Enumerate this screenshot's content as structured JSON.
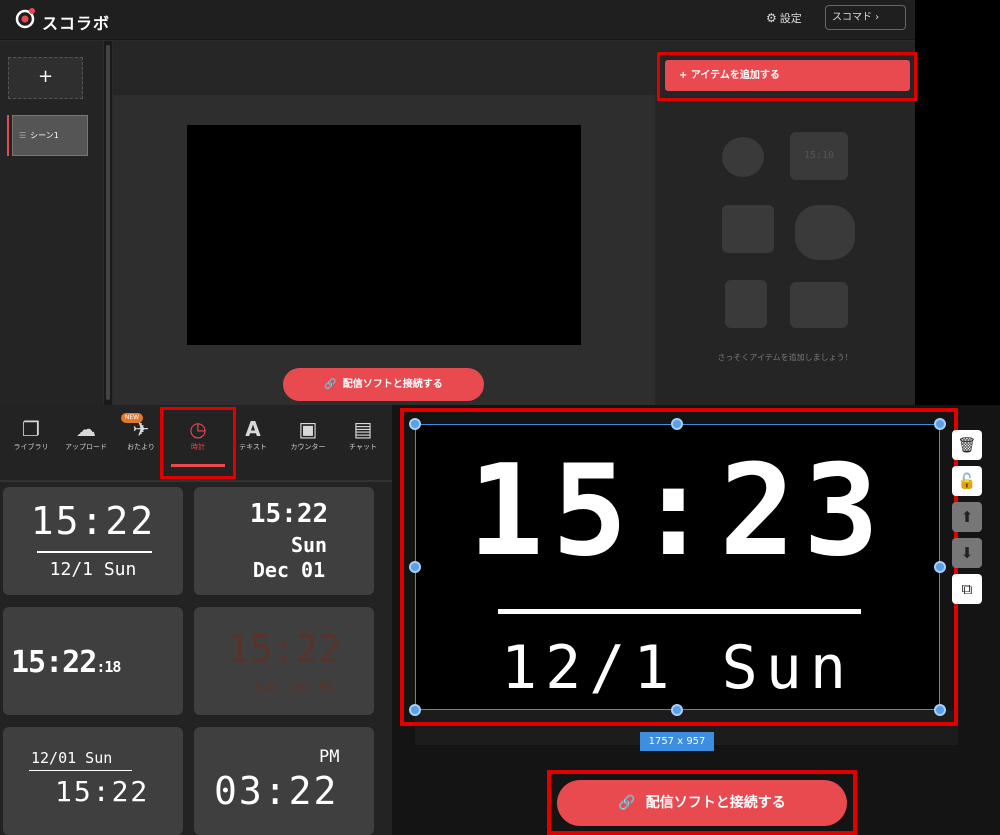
{
  "app": {
    "brand": "スコラボ",
    "settings_label": "設定",
    "sukomado_label": "スコマド ›"
  },
  "scenes": {
    "add_label": "+",
    "items": [
      {
        "label": "シーン1"
      }
    ]
  },
  "items_panel": {
    "add_item_label": "+ アイテムを追加する",
    "empty_hint": "さっそくアイテムを追加しましょう！",
    "illustration_clock": "15:10"
  },
  "connect_label": "配信ソフトと接続する",
  "library_tabs": [
    {
      "label": "ライブラリ",
      "icon": "library-icon"
    },
    {
      "label": "アップロード",
      "icon": "upload-icon"
    },
    {
      "label": "おたより",
      "icon": "paper-plane-icon",
      "badge": "NEW"
    },
    {
      "label": "時計",
      "icon": "clock-icon",
      "active": true
    },
    {
      "label": "テキスト",
      "icon": "text-icon"
    },
    {
      "label": "カウンター",
      "icon": "counter-icon"
    },
    {
      "label": "チャット",
      "icon": "chat-icon"
    }
  ],
  "clock_presets": [
    {
      "time": "15:22",
      "date": "12/1 Sun"
    },
    {
      "time": "15:22",
      "day": "Sun",
      "date": "Dec 01"
    },
    {
      "time": "15:22",
      "seconds": ":18"
    },
    {
      "time": "15:22",
      "date": "Sun, Dec 01"
    },
    {
      "date": "12/01 Sun",
      "time": "15:22"
    },
    {
      "ampm": "PM",
      "time": "03:22"
    }
  ],
  "canvas": {
    "time": "15:23",
    "date": "12/1 Sun",
    "size_label": "1757 x 957"
  },
  "colors": {
    "accent": "#e84a4f",
    "highlight": "#e10000",
    "selection": "#3d8de0"
  }
}
